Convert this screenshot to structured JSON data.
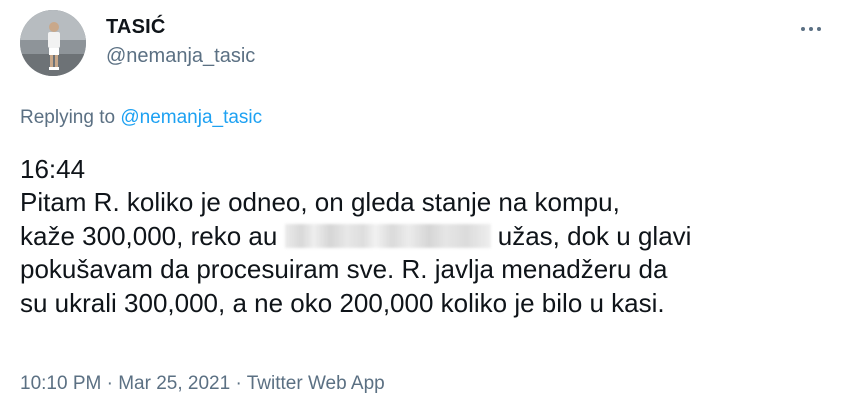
{
  "user": {
    "display_name": "TASIĆ",
    "handle": "@nemanja_tasic"
  },
  "reply": {
    "prefix": "Replying to",
    "mention": "@nemanja_tasic"
  },
  "tweet": {
    "lines": [
      "16:44",
      "Pitam R. koliko je odneo, on gleda stanje na kompu,",
      "kaže 300,000, reko au",
      "užas, dok u glavi",
      "pokušavam da procesuiram sve. R. javlja menadžeru da",
      "su ukrali 300,000, a ne oko 200,000 koliko je bilo u kasi."
    ]
  },
  "meta": {
    "time": "10:10 PM",
    "separator": "·",
    "date": "Mar 25, 2021",
    "app": "Twitter Web App"
  },
  "icons": {
    "avatar": "profile-photo",
    "more": "more-options-icon"
  }
}
